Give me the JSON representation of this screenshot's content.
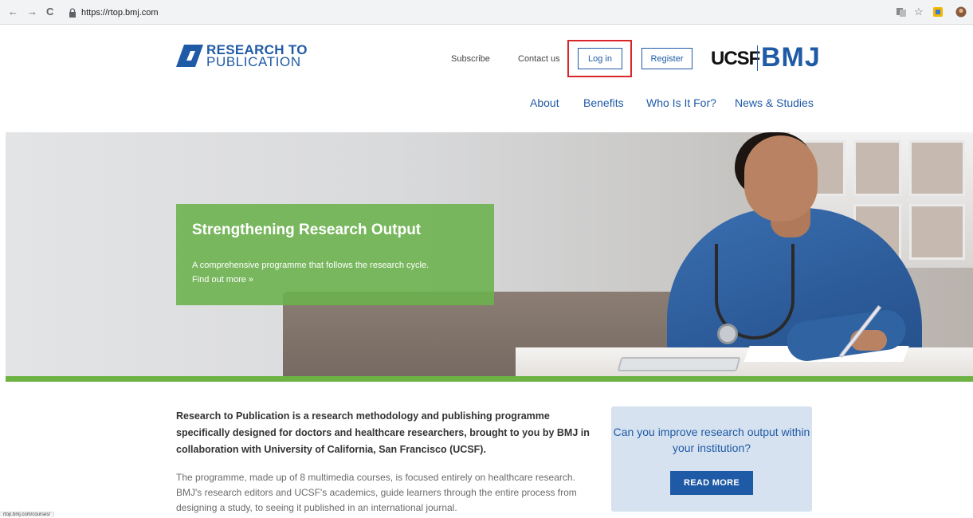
{
  "browser": {
    "back": "←",
    "forward": "→",
    "reload": "C",
    "url": "https://rtop.bmj.com",
    "status_url": "rtop.bmj.com/courses/"
  },
  "header": {
    "logo_line1": "RESEARCH TO",
    "logo_line2": "PUBLICATION",
    "subscribe": "Subscribe",
    "contact": "Contact us",
    "login": "Log in",
    "register": "Register",
    "ucsf": "UCSF",
    "bmj": "BMJ"
  },
  "nav": {
    "items": [
      "About",
      "Benefits",
      "Who Is It For?",
      "News & Studies"
    ]
  },
  "hero": {
    "title": "Strengthening Research Output",
    "subtitle": "A comprehensive programme that follows the research cycle.",
    "link": "Find out more »"
  },
  "content": {
    "intro": "Research to Publication is a research methodology and publishing programme specifically designed for doctors and healthcare researchers, brought to you by BMJ in collaboration with University of California, San Francisco (UCSF).",
    "body": "The programme, made up of 8 multimedia courses, is focused entirely on healthcare research. BMJ's research editors and UCSF's academics, guide learners through the entire process from designing a study, to seeing it published in an international journal."
  },
  "cta": {
    "text": "Can you improve research output within your institution?",
    "button": "READ MORE"
  },
  "colors": {
    "brand_blue": "#1f5aa6",
    "hero_green": "#6cb343",
    "highlight_red": "#d9262b"
  }
}
